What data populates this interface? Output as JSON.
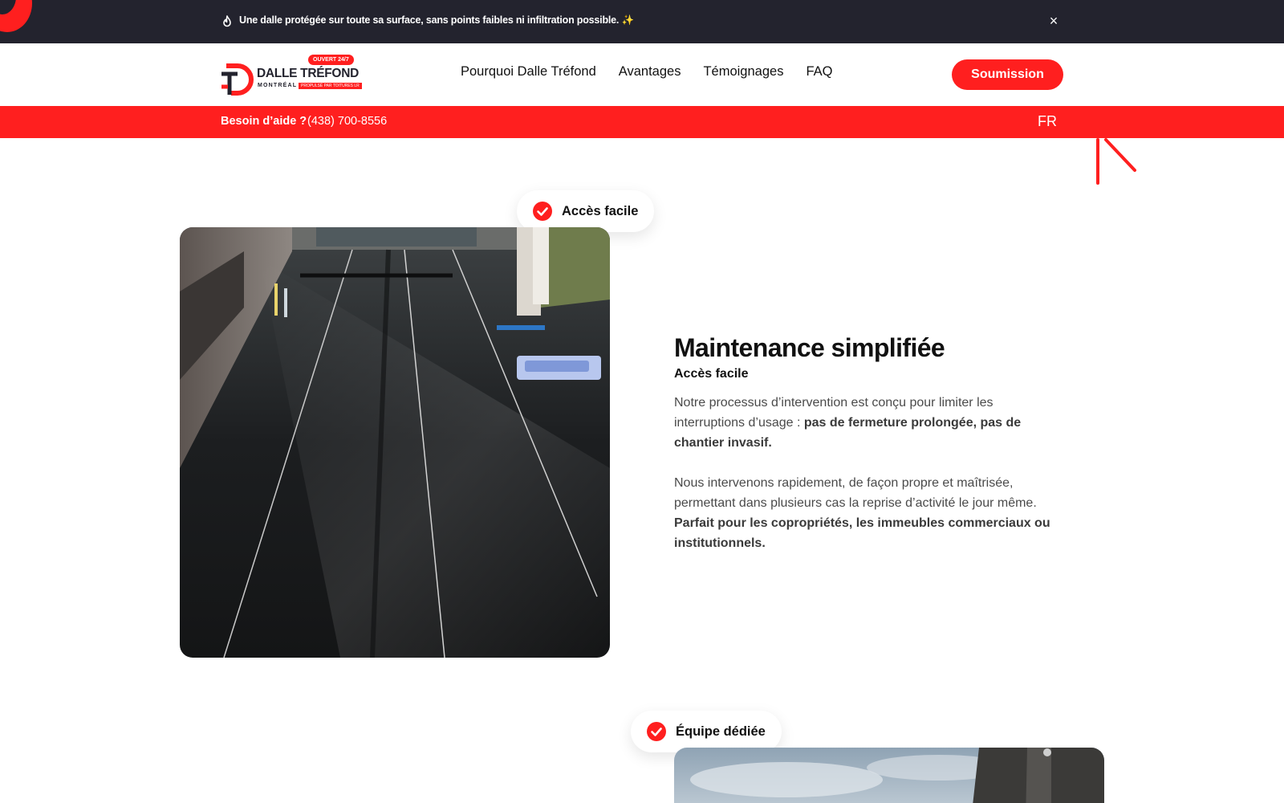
{
  "announcement": {
    "message": "Une dalle protégée sur toute sa surface, sans points faibles ni infiltration possible. ✨",
    "close": "×",
    "icon": "fire-icon"
  },
  "header": {
    "logo": {
      "badge": "OUVERT 24/7",
      "brand": "DALLE TRÉFOND",
      "city": "MONTRÉAL",
      "tagline": "PROPULSÉ PAR TOITURES LR"
    },
    "nav": [
      "Pourquoi Dalle Tréfond",
      "Avantages",
      "Témoignages",
      "FAQ"
    ],
    "cta": "Soumission"
  },
  "help_bar": {
    "label": "Besoin d’aide ?",
    "phone": "(438) 700-8556",
    "lang": "FR"
  },
  "section1": {
    "pill": "Accès facile",
    "title": "Maintenance simplifiée",
    "subtitle": "Accès facile",
    "p1_start": "Notre processus d’intervention est conçu pour limiter les interruptions d’usage : ",
    "p1_bold": "pas de fermeture prolongée, pas de chantier invasif.",
    "p2_start": "Nous intervenons rapidement, de façon propre et maîtrisée, permettant dans plusieurs cas la reprise d’activité le jour même. ",
    "p2_bold": "Parfait pour les copropriétés, les immeubles commerciaux ou institutionnels."
  },
  "section2": {
    "pill": "Équipe dédiée"
  },
  "colors": {
    "accent": "#ff1f1f",
    "dark": "#23232e"
  }
}
